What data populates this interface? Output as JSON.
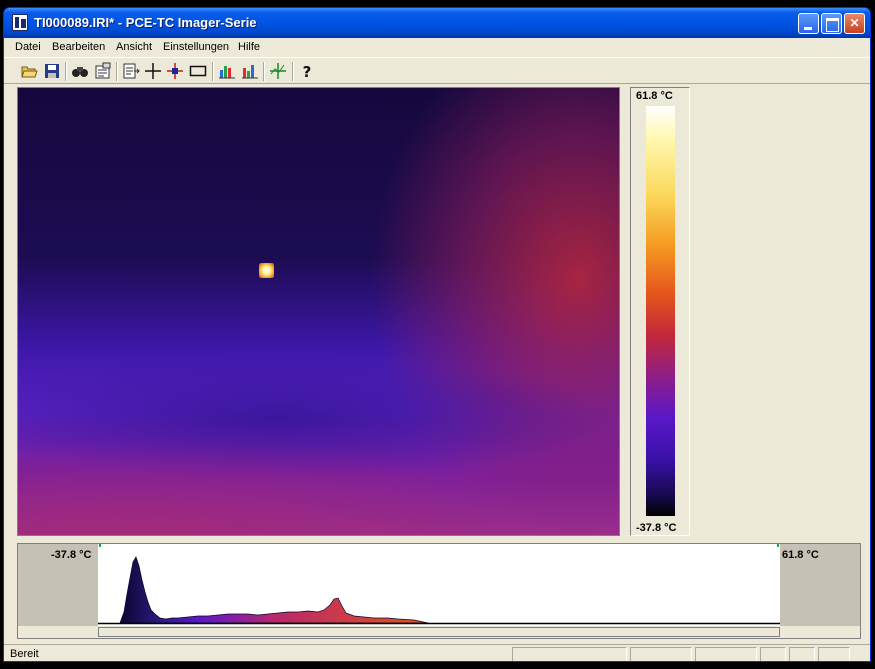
{
  "window": {
    "title": "TI000089.IRI* - PCE-TC Imager-Serie"
  },
  "menu": {
    "items": [
      {
        "label": "Datei",
        "name": "menu-datei"
      },
      {
        "label": "Bearbeiten",
        "name": "menu-bearbeiten"
      },
      {
        "label": "Ansicht",
        "name": "menu-ansicht"
      },
      {
        "label": "Einstellungen",
        "name": "menu-einstellungen"
      },
      {
        "label": "Hilfe",
        "name": "menu-hilfe"
      }
    ]
  },
  "toolbar": {
    "icons": [
      "open-folder-icon",
      "save-icon",
      "binoculars-icon",
      "properties-icon",
      "export-icon",
      "crosshair-icon",
      "spot-marker-icon",
      "rectangle-icon",
      "histogram-icon",
      "bar-chart-icon",
      "profile-icon",
      "help-icon"
    ]
  },
  "thermal_image": {
    "hotspot_icon": "hotspot-marker"
  },
  "scale": {
    "max": "61.8 °C",
    "min": "-37.8 °C"
  },
  "histogram": {
    "min_label": "-37.8 °C",
    "max_label": "61.8 °C"
  },
  "status": {
    "text": "Bereit"
  }
}
